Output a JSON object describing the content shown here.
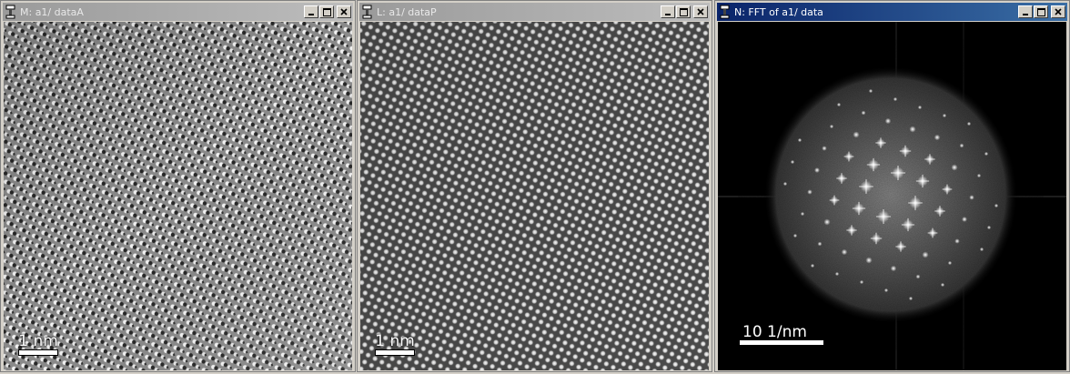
{
  "windows": [
    {
      "title": "M: a1/ dataA",
      "active": false,
      "scalebar": {
        "label": "1 nm"
      }
    },
    {
      "title": "L: a1/ dataP",
      "active": false,
      "scalebar": {
        "label": "1 nm"
      }
    },
    {
      "title": "N: FFT of a1/ data",
      "active": true,
      "scalebar": {
        "label": "10 1/nm"
      }
    }
  ],
  "title_buttons": {
    "minimize": "_",
    "maximize": "□",
    "close": "x"
  },
  "icons": [
    "app-icon",
    "minimize-icon",
    "maximize-icon",
    "close-icon"
  ],
  "colors": {
    "active_title": "#0a246a",
    "inactive_title": "#9a9a9a",
    "window_bg": "#d4d0c8"
  }
}
